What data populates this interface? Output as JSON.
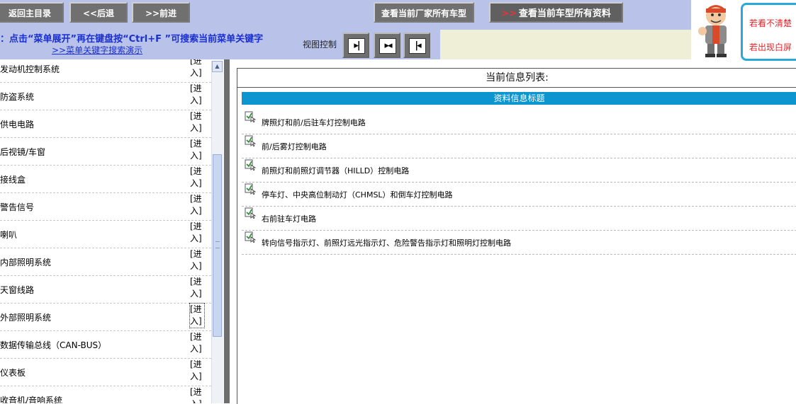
{
  "toolbar": {
    "home_label": "返回主目录",
    "back_label": "<<后退",
    "forward_label": ">>前进",
    "all_models_label": "查看当前厂家所有车型",
    "all_info_label": "查看当前车型所有资料",
    "all_info_chevron": ">>"
  },
  "hint": {
    "text": "：点击“菜单展开”再在键盘按“Ctrl+F ”可搜索当前菜单关键字",
    "link": ">>菜单关键字搜索演示"
  },
  "view_control": {
    "label": "视图控制",
    "buttons": [
      "show-left",
      "show-both",
      "show-right"
    ]
  },
  "helper": {
    "line1": "若看不清楚",
    "line2": "若出现白屏"
  },
  "menu": {
    "enter_label": "[进入]",
    "items": [
      {
        "label": "发动机控制系统"
      },
      {
        "label": "防盗系统"
      },
      {
        "label": "供电电路"
      },
      {
        "label": "后视镜/车窗"
      },
      {
        "label": "接线盒"
      },
      {
        "label": "警告信号"
      },
      {
        "label": "喇叭"
      },
      {
        "label": "内部照明系统"
      },
      {
        "label": "天窗线路"
      },
      {
        "label": "外部照明系统"
      },
      {
        "label": "数据传输总线（CAN-BUS）"
      },
      {
        "label": "仪表板"
      },
      {
        "label": "收音机/音响系统"
      }
    ]
  },
  "content": {
    "title": "当前信息列表:",
    "table_header": "资料信息标题",
    "rows": [
      {
        "text": "牌照灯和前/后驻车灯控制电路"
      },
      {
        "text": "前/后雾灯控制电路"
      },
      {
        "text": "前照灯和前照灯调节器（HILLD）控制电路"
      },
      {
        "text": "停车灯、中央高位制动灯（CHMSL）和倒车灯控制电路"
      },
      {
        "text": "右前驻车灯电路"
      },
      {
        "text": "转向信号指示灯、前照灯远光指示灯、危险警告指示灯和照明灯控制电路"
      }
    ]
  },
  "colors": {
    "toolbar_bg": "#b9c3e9",
    "hint_text": "#1a2fd0",
    "table_header_bg": "#0d95d0",
    "help_border": "#29a9d9",
    "help_text": "#e0262b"
  }
}
